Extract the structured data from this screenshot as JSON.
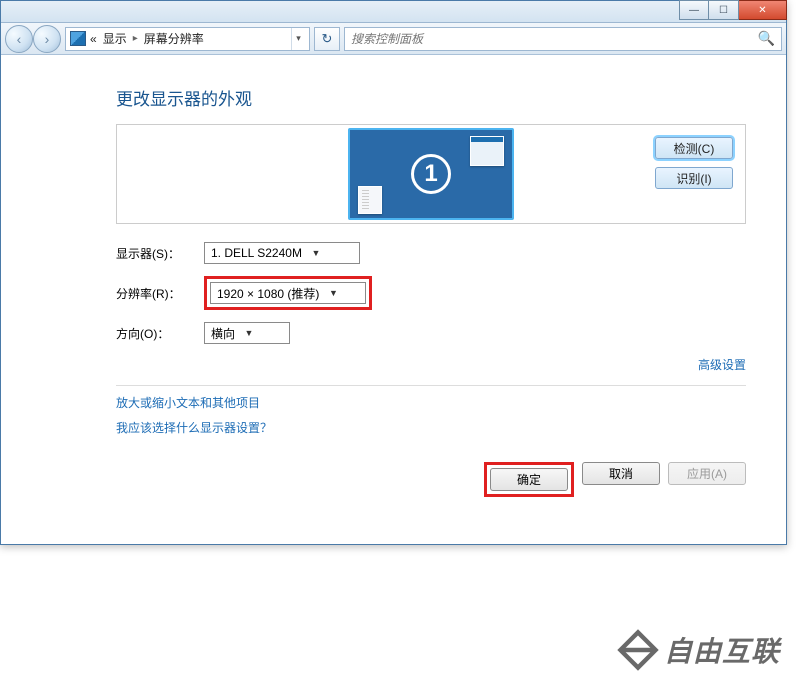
{
  "titlebar": {
    "min_glyph": "—",
    "max_glyph": "☐",
    "close_glyph": "✕"
  },
  "nav": {
    "back_glyph": "‹",
    "fwd_glyph": "›",
    "addr_prefix": "«",
    "addr_seg1": "显示",
    "addr_seg2": "屏幕分辨率",
    "chevron": "▸",
    "refresh_glyph": "↻",
    "search_placeholder": "搜索控制面板",
    "search_glyph": "🔍"
  },
  "heading": "更改显示器的外观",
  "preview": {
    "monitor_number": "1",
    "detect_label": "检测(C)",
    "identify_label": "识别(I)"
  },
  "rows": {
    "monitor_label": "显示器(S)：",
    "monitor_value": "1. DELL S2240M",
    "resolution_label": "分辨率(R)：",
    "resolution_value": "1920 × 1080 (推荐)",
    "orientation_label": "方向(O)：",
    "orientation_value": "横向"
  },
  "advanced_link": "高级设置",
  "links": {
    "text_size": "放大或缩小文本和其他项目",
    "help": "我应该选择什么显示器设置？"
  },
  "buttons": {
    "ok": "确定",
    "cancel": "取消",
    "apply": "应用(A)"
  },
  "watermark": "自由互联"
}
